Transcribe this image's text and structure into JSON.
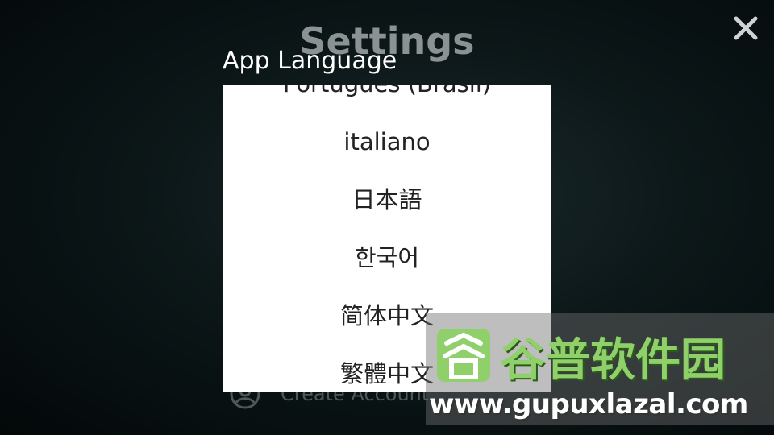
{
  "background": {
    "title": "Settings",
    "create_account_label": "Create Account"
  },
  "dialog": {
    "title": "App Language",
    "languages": [
      "Português (Brasil)",
      "italiano",
      "日本語",
      "한국어",
      "简体中文",
      "繁體中文"
    ]
  },
  "close_icon": "close-icon",
  "watermark": {
    "brand": "谷普软件园",
    "url": "www.gupuxlazal.com"
  },
  "colors": {
    "dialog_background": "#ffffff",
    "list_text": "#222222",
    "title_text": "#ffffff",
    "watermark_green": "#8fd06a"
  }
}
